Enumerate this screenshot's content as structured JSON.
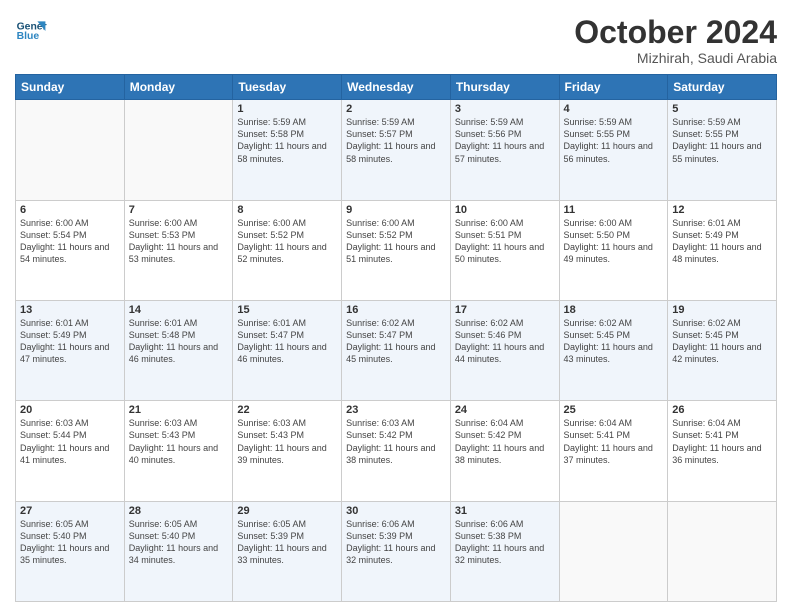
{
  "header": {
    "logo": {
      "line1": "General",
      "line2": "Blue"
    },
    "title": "October 2024",
    "subtitle": "Mizhirah, Saudi Arabia"
  },
  "weekdays": [
    "Sunday",
    "Monday",
    "Tuesday",
    "Wednesday",
    "Thursday",
    "Friday",
    "Saturday"
  ],
  "weeks": [
    [
      {
        "day": "",
        "info": ""
      },
      {
        "day": "",
        "info": ""
      },
      {
        "day": "1",
        "info": "Sunrise: 5:59 AM\nSunset: 5:58 PM\nDaylight: 11 hours and 58 minutes."
      },
      {
        "day": "2",
        "info": "Sunrise: 5:59 AM\nSunset: 5:57 PM\nDaylight: 11 hours and 58 minutes."
      },
      {
        "day": "3",
        "info": "Sunrise: 5:59 AM\nSunset: 5:56 PM\nDaylight: 11 hours and 57 minutes."
      },
      {
        "day": "4",
        "info": "Sunrise: 5:59 AM\nSunset: 5:55 PM\nDaylight: 11 hours and 56 minutes."
      },
      {
        "day": "5",
        "info": "Sunrise: 5:59 AM\nSunset: 5:55 PM\nDaylight: 11 hours and 55 minutes."
      }
    ],
    [
      {
        "day": "6",
        "info": "Sunrise: 6:00 AM\nSunset: 5:54 PM\nDaylight: 11 hours and 54 minutes."
      },
      {
        "day": "7",
        "info": "Sunrise: 6:00 AM\nSunset: 5:53 PM\nDaylight: 11 hours and 53 minutes."
      },
      {
        "day": "8",
        "info": "Sunrise: 6:00 AM\nSunset: 5:52 PM\nDaylight: 11 hours and 52 minutes."
      },
      {
        "day": "9",
        "info": "Sunrise: 6:00 AM\nSunset: 5:52 PM\nDaylight: 11 hours and 51 minutes."
      },
      {
        "day": "10",
        "info": "Sunrise: 6:00 AM\nSunset: 5:51 PM\nDaylight: 11 hours and 50 minutes."
      },
      {
        "day": "11",
        "info": "Sunrise: 6:00 AM\nSunset: 5:50 PM\nDaylight: 11 hours and 49 minutes."
      },
      {
        "day": "12",
        "info": "Sunrise: 6:01 AM\nSunset: 5:49 PM\nDaylight: 11 hours and 48 minutes."
      }
    ],
    [
      {
        "day": "13",
        "info": "Sunrise: 6:01 AM\nSunset: 5:49 PM\nDaylight: 11 hours and 47 minutes."
      },
      {
        "day": "14",
        "info": "Sunrise: 6:01 AM\nSunset: 5:48 PM\nDaylight: 11 hours and 46 minutes."
      },
      {
        "day": "15",
        "info": "Sunrise: 6:01 AM\nSunset: 5:47 PM\nDaylight: 11 hours and 46 minutes."
      },
      {
        "day": "16",
        "info": "Sunrise: 6:02 AM\nSunset: 5:47 PM\nDaylight: 11 hours and 45 minutes."
      },
      {
        "day": "17",
        "info": "Sunrise: 6:02 AM\nSunset: 5:46 PM\nDaylight: 11 hours and 44 minutes."
      },
      {
        "day": "18",
        "info": "Sunrise: 6:02 AM\nSunset: 5:45 PM\nDaylight: 11 hours and 43 minutes."
      },
      {
        "day": "19",
        "info": "Sunrise: 6:02 AM\nSunset: 5:45 PM\nDaylight: 11 hours and 42 minutes."
      }
    ],
    [
      {
        "day": "20",
        "info": "Sunrise: 6:03 AM\nSunset: 5:44 PM\nDaylight: 11 hours and 41 minutes."
      },
      {
        "day": "21",
        "info": "Sunrise: 6:03 AM\nSunset: 5:43 PM\nDaylight: 11 hours and 40 minutes."
      },
      {
        "day": "22",
        "info": "Sunrise: 6:03 AM\nSunset: 5:43 PM\nDaylight: 11 hours and 39 minutes."
      },
      {
        "day": "23",
        "info": "Sunrise: 6:03 AM\nSunset: 5:42 PM\nDaylight: 11 hours and 38 minutes."
      },
      {
        "day": "24",
        "info": "Sunrise: 6:04 AM\nSunset: 5:42 PM\nDaylight: 11 hours and 38 minutes."
      },
      {
        "day": "25",
        "info": "Sunrise: 6:04 AM\nSunset: 5:41 PM\nDaylight: 11 hours and 37 minutes."
      },
      {
        "day": "26",
        "info": "Sunrise: 6:04 AM\nSunset: 5:41 PM\nDaylight: 11 hours and 36 minutes."
      }
    ],
    [
      {
        "day": "27",
        "info": "Sunrise: 6:05 AM\nSunset: 5:40 PM\nDaylight: 11 hours and 35 minutes."
      },
      {
        "day": "28",
        "info": "Sunrise: 6:05 AM\nSunset: 5:40 PM\nDaylight: 11 hours and 34 minutes."
      },
      {
        "day": "29",
        "info": "Sunrise: 6:05 AM\nSunset: 5:39 PM\nDaylight: 11 hours and 33 minutes."
      },
      {
        "day": "30",
        "info": "Sunrise: 6:06 AM\nSunset: 5:39 PM\nDaylight: 11 hours and 32 minutes."
      },
      {
        "day": "31",
        "info": "Sunrise: 6:06 AM\nSunset: 5:38 PM\nDaylight: 11 hours and 32 minutes."
      },
      {
        "day": "",
        "info": ""
      },
      {
        "day": "",
        "info": ""
      }
    ]
  ]
}
